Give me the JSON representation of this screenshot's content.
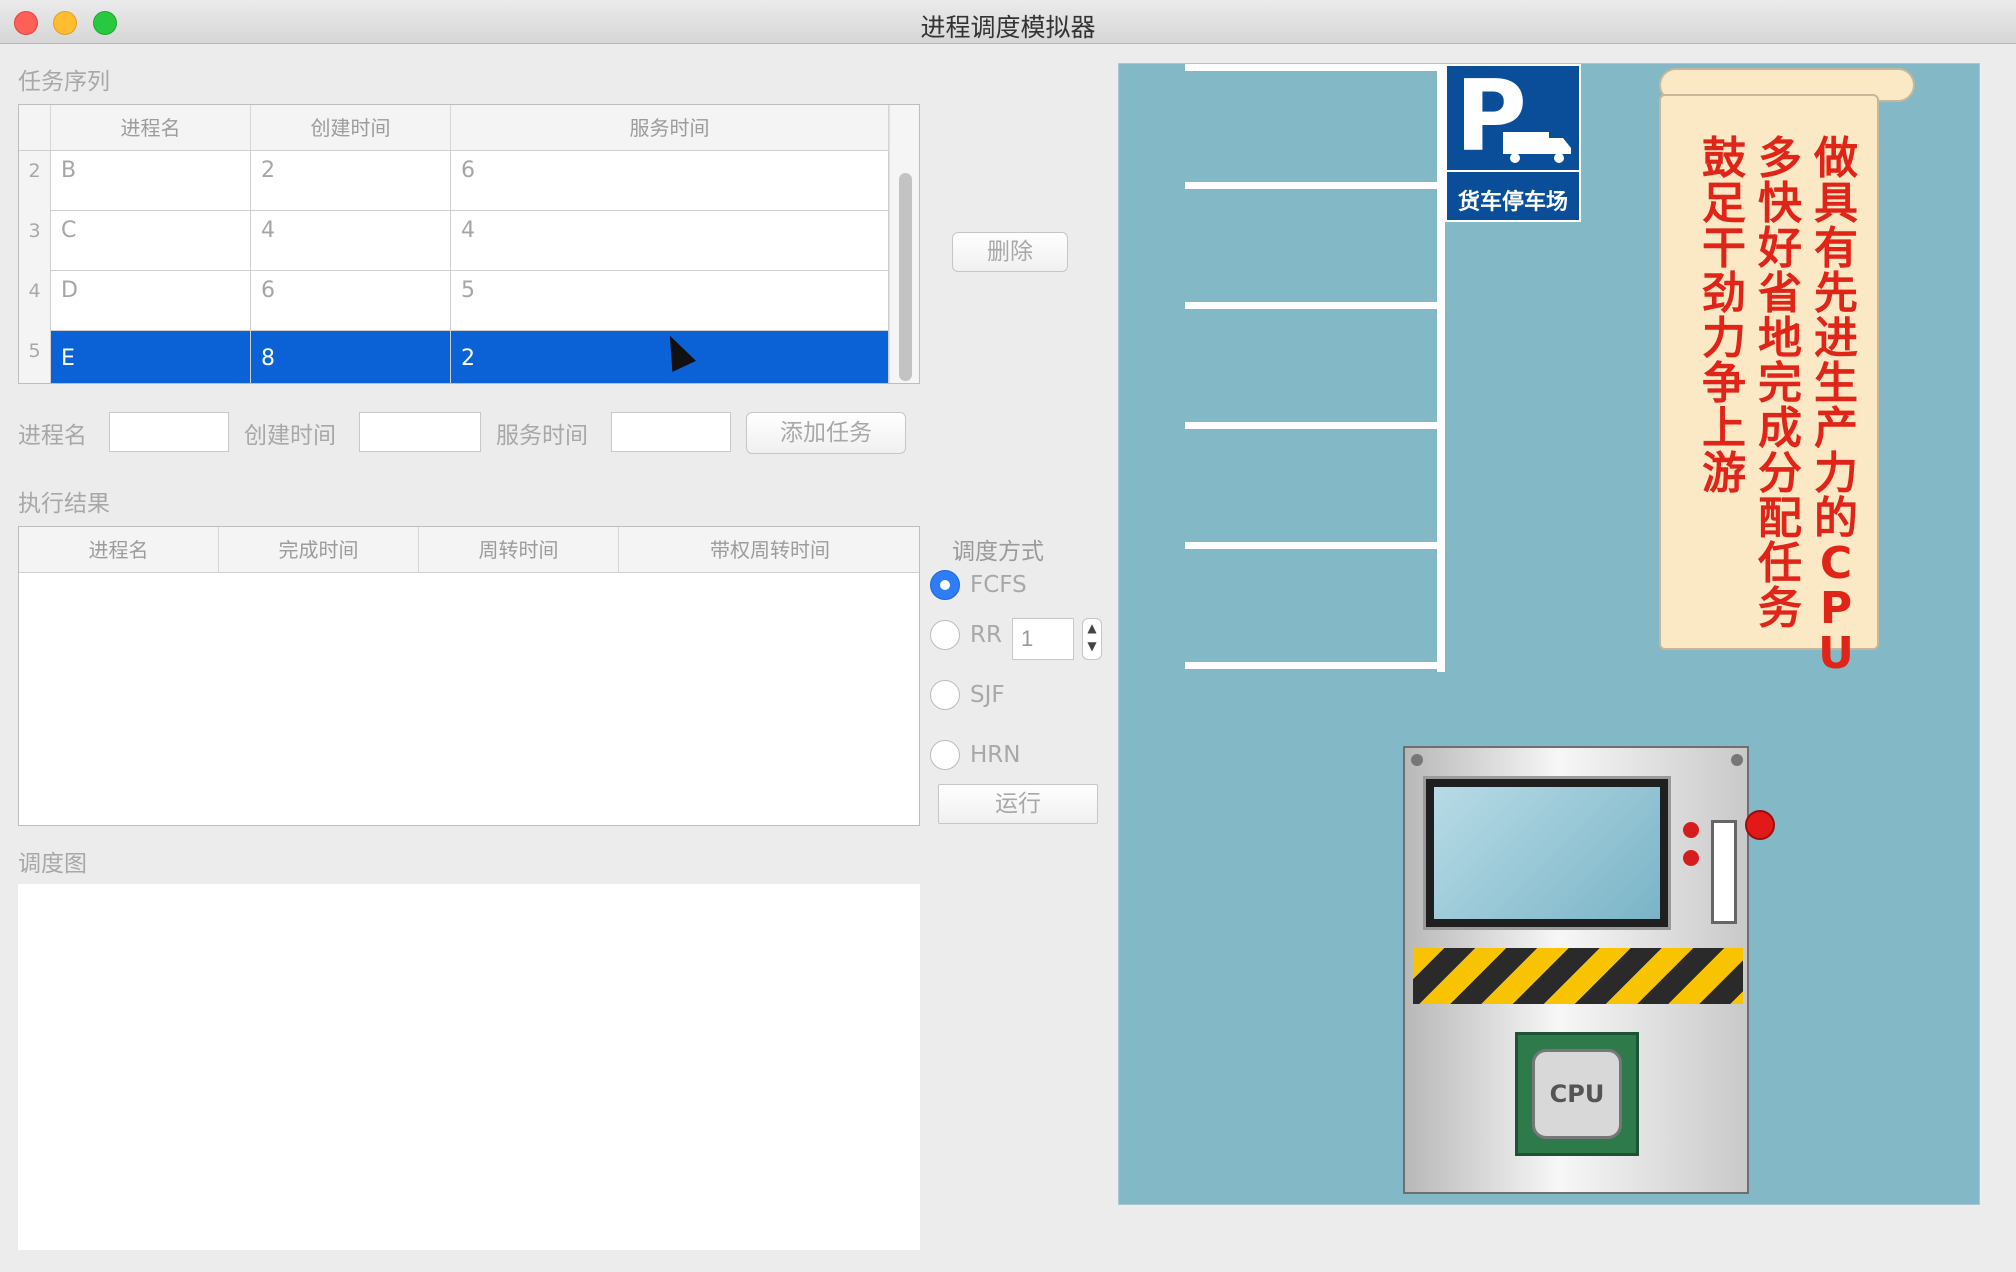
{
  "window": {
    "title": "进程调度模拟器"
  },
  "task_queue": {
    "label": "任务序列",
    "columns": [
      "进程名",
      "创建时间",
      "服务时间"
    ],
    "rows": [
      {
        "num": "2",
        "name": "B",
        "create": "2",
        "service": "6"
      },
      {
        "num": "3",
        "name": "C",
        "create": "4",
        "service": "4"
      },
      {
        "num": "4",
        "name": "D",
        "create": "6",
        "service": "5"
      },
      {
        "num": "5",
        "name": "E",
        "create": "8",
        "service": "2",
        "selected": true
      }
    ],
    "delete_button": "删除"
  },
  "add_form": {
    "name_label": "进程名",
    "name_value": "",
    "create_label": "创建时间",
    "create_value": "",
    "service_label": "服务时间",
    "service_value": "",
    "add_button": "添加任务"
  },
  "results": {
    "label": "执行结果",
    "columns": [
      "进程名",
      "完成时间",
      "周转时间",
      "带权周转时间"
    ],
    "rows": []
  },
  "schedule": {
    "label": "调度方式",
    "options": [
      {
        "label": "FCFS",
        "selected": true
      },
      {
        "label": "RR",
        "selected": false
      },
      {
        "label": "SJF",
        "selected": false
      },
      {
        "label": "HRN",
        "selected": false
      }
    ],
    "rr_quantum": "1",
    "run_button": "运行"
  },
  "chart": {
    "label": "调度图"
  },
  "scene": {
    "parking_sign_letter": "P",
    "parking_sign_text": "货车停车场",
    "slogan_columns": [
      "做具有先进生产力的CPU",
      "多快好省地完成分配任务",
      "鼓足干劲 力争上游"
    ],
    "chip_text": "CPU"
  },
  "colors": {
    "selection": "#0b62d6",
    "scene_bg": "#83b9c7",
    "slogan": "#e02418"
  }
}
